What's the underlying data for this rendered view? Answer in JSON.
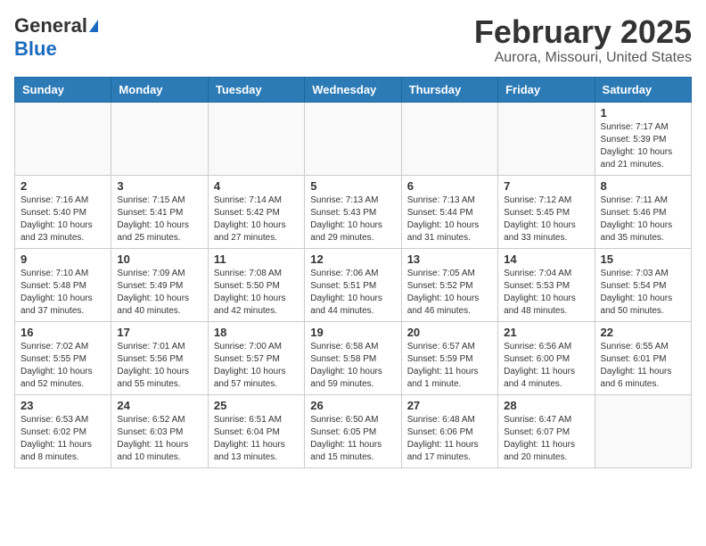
{
  "header": {
    "logo_general": "General",
    "logo_blue": "Blue",
    "month": "February 2025",
    "location": "Aurora, Missouri, United States"
  },
  "weekdays": [
    "Sunday",
    "Monday",
    "Tuesday",
    "Wednesday",
    "Thursday",
    "Friday",
    "Saturday"
  ],
  "weeks": [
    [
      {
        "day": "",
        "info": ""
      },
      {
        "day": "",
        "info": ""
      },
      {
        "day": "",
        "info": ""
      },
      {
        "day": "",
        "info": ""
      },
      {
        "day": "",
        "info": ""
      },
      {
        "day": "",
        "info": ""
      },
      {
        "day": "1",
        "info": "Sunrise: 7:17 AM\nSunset: 5:39 PM\nDaylight: 10 hours\nand 21 minutes."
      }
    ],
    [
      {
        "day": "2",
        "info": "Sunrise: 7:16 AM\nSunset: 5:40 PM\nDaylight: 10 hours\nand 23 minutes."
      },
      {
        "day": "3",
        "info": "Sunrise: 7:15 AM\nSunset: 5:41 PM\nDaylight: 10 hours\nand 25 minutes."
      },
      {
        "day": "4",
        "info": "Sunrise: 7:14 AM\nSunset: 5:42 PM\nDaylight: 10 hours\nand 27 minutes."
      },
      {
        "day": "5",
        "info": "Sunrise: 7:13 AM\nSunset: 5:43 PM\nDaylight: 10 hours\nand 29 minutes."
      },
      {
        "day": "6",
        "info": "Sunrise: 7:13 AM\nSunset: 5:44 PM\nDaylight: 10 hours\nand 31 minutes."
      },
      {
        "day": "7",
        "info": "Sunrise: 7:12 AM\nSunset: 5:45 PM\nDaylight: 10 hours\nand 33 minutes."
      },
      {
        "day": "8",
        "info": "Sunrise: 7:11 AM\nSunset: 5:46 PM\nDaylight: 10 hours\nand 35 minutes."
      }
    ],
    [
      {
        "day": "9",
        "info": "Sunrise: 7:10 AM\nSunset: 5:48 PM\nDaylight: 10 hours\nand 37 minutes."
      },
      {
        "day": "10",
        "info": "Sunrise: 7:09 AM\nSunset: 5:49 PM\nDaylight: 10 hours\nand 40 minutes."
      },
      {
        "day": "11",
        "info": "Sunrise: 7:08 AM\nSunset: 5:50 PM\nDaylight: 10 hours\nand 42 minutes."
      },
      {
        "day": "12",
        "info": "Sunrise: 7:06 AM\nSunset: 5:51 PM\nDaylight: 10 hours\nand 44 minutes."
      },
      {
        "day": "13",
        "info": "Sunrise: 7:05 AM\nSunset: 5:52 PM\nDaylight: 10 hours\nand 46 minutes."
      },
      {
        "day": "14",
        "info": "Sunrise: 7:04 AM\nSunset: 5:53 PM\nDaylight: 10 hours\nand 48 minutes."
      },
      {
        "day": "15",
        "info": "Sunrise: 7:03 AM\nSunset: 5:54 PM\nDaylight: 10 hours\nand 50 minutes."
      }
    ],
    [
      {
        "day": "16",
        "info": "Sunrise: 7:02 AM\nSunset: 5:55 PM\nDaylight: 10 hours\nand 52 minutes."
      },
      {
        "day": "17",
        "info": "Sunrise: 7:01 AM\nSunset: 5:56 PM\nDaylight: 10 hours\nand 55 minutes."
      },
      {
        "day": "18",
        "info": "Sunrise: 7:00 AM\nSunset: 5:57 PM\nDaylight: 10 hours\nand 57 minutes."
      },
      {
        "day": "19",
        "info": "Sunrise: 6:58 AM\nSunset: 5:58 PM\nDaylight: 10 hours\nand 59 minutes."
      },
      {
        "day": "20",
        "info": "Sunrise: 6:57 AM\nSunset: 5:59 PM\nDaylight: 11 hours\nand 1 minute."
      },
      {
        "day": "21",
        "info": "Sunrise: 6:56 AM\nSunset: 6:00 PM\nDaylight: 11 hours\nand 4 minutes."
      },
      {
        "day": "22",
        "info": "Sunrise: 6:55 AM\nSunset: 6:01 PM\nDaylight: 11 hours\nand 6 minutes."
      }
    ],
    [
      {
        "day": "23",
        "info": "Sunrise: 6:53 AM\nSunset: 6:02 PM\nDaylight: 11 hours\nand 8 minutes."
      },
      {
        "day": "24",
        "info": "Sunrise: 6:52 AM\nSunset: 6:03 PM\nDaylight: 11 hours\nand 10 minutes."
      },
      {
        "day": "25",
        "info": "Sunrise: 6:51 AM\nSunset: 6:04 PM\nDaylight: 11 hours\nand 13 minutes."
      },
      {
        "day": "26",
        "info": "Sunrise: 6:50 AM\nSunset: 6:05 PM\nDaylight: 11 hours\nand 15 minutes."
      },
      {
        "day": "27",
        "info": "Sunrise: 6:48 AM\nSunset: 6:06 PM\nDaylight: 11 hours\nand 17 minutes."
      },
      {
        "day": "28",
        "info": "Sunrise: 6:47 AM\nSunset: 6:07 PM\nDaylight: 11 hours\nand 20 minutes."
      },
      {
        "day": "",
        "info": ""
      }
    ]
  ]
}
